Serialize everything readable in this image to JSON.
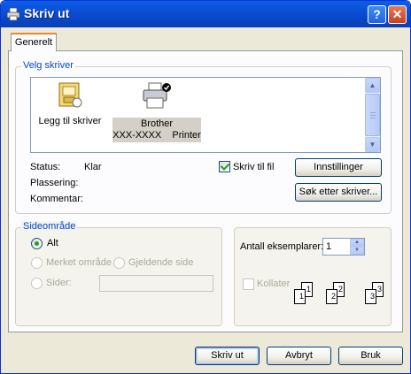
{
  "window": {
    "title": "Skriv ut",
    "help_label": "?",
    "close_label": "✕"
  },
  "tabs": [
    {
      "label": "Generelt",
      "selected": true
    }
  ],
  "select_printer": {
    "group_title": "Velg skriver",
    "printers": [
      {
        "label": "Legg til skriver",
        "icon": "add-printer-icon"
      },
      {
        "label_line1": "Brother",
        "label_line2": "XXX-XXXX    Printer",
        "icon": "printer-icon",
        "selected": true,
        "default": true
      }
    ],
    "status_label": "Status:",
    "status_value": "Klar",
    "location_label": "Plassering:",
    "comment_label": "Kommentar:",
    "print_to_file_label": "Skriv til fil",
    "print_to_file_checked": true,
    "preferences_button": "Innstillinger",
    "find_printer_button": "Søk etter skriver..."
  },
  "page_range": {
    "group_title": "Sideområde",
    "all_label": "Alt",
    "selection_label": "Merket område",
    "current_page_label": "Gjeldende side",
    "pages_label": "Sider:",
    "pages_value": ""
  },
  "copies": {
    "number_label": "Antall eksemplarer:",
    "number_value": "1",
    "collate_label": "Kollater",
    "collate_checked": false,
    "collate_pages": [
      "1",
      "1",
      "2",
      "2",
      "3",
      "3"
    ]
  },
  "buttons": {
    "print": "Skriv ut",
    "cancel": "Avbryt",
    "apply": "Bruk"
  },
  "colors": {
    "titlebar": "#0a5fe6",
    "dialog_bg": "#ece9d8",
    "group_title": "#0046d5",
    "check_green": "#21a121"
  }
}
